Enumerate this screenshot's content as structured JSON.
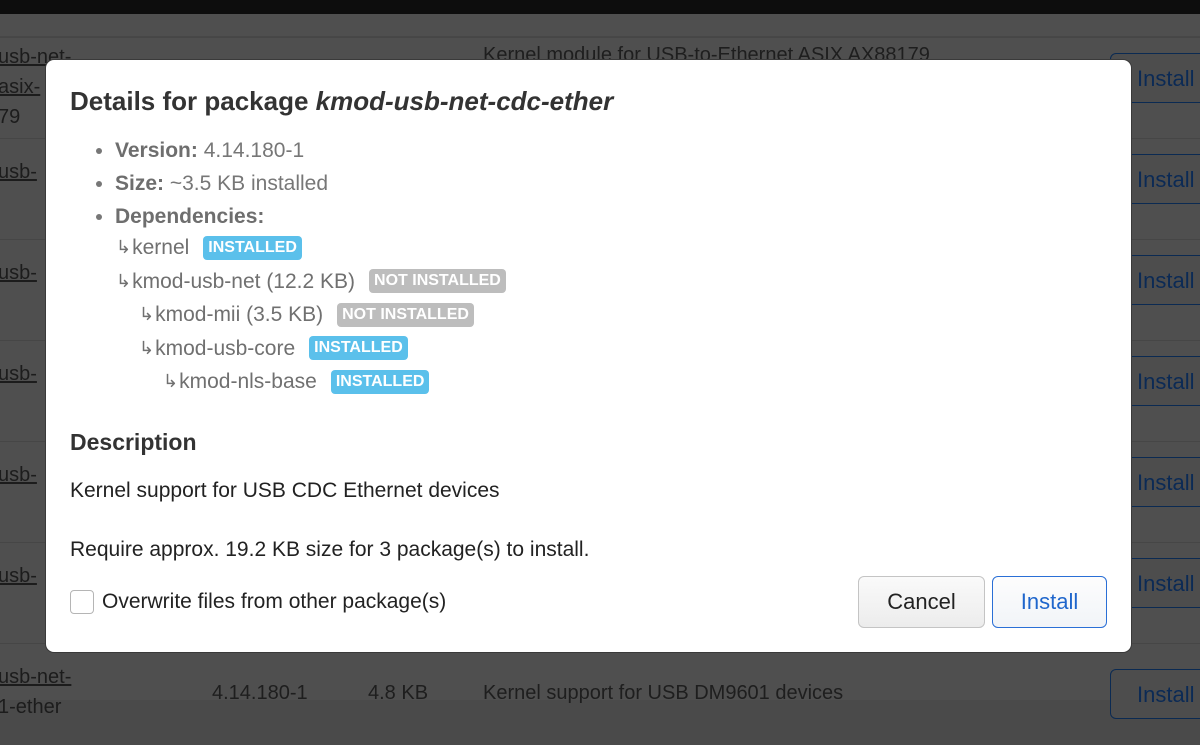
{
  "background": {
    "rows": [
      {
        "pkg_line1": "usb-net-asix-",
        "pkg_line2": "79",
        "version": "",
        "size": "",
        "desc": "Kernel module for USB-to-Ethernet ASIX AX88179",
        "install_label": "Install"
      },
      {
        "pkg_line1": "usb-",
        "pkg_line2": "",
        "version": "",
        "size": "",
        "desc": "",
        "install_label": "Install"
      },
      {
        "pkg_line1": "usb-",
        "pkg_line2": "",
        "version": "",
        "size": "",
        "desc": "",
        "install_label": "Install"
      },
      {
        "pkg_line1": "usb-",
        "pkg_line2": "",
        "version": "",
        "size": "",
        "desc": "",
        "install_label": "Install"
      },
      {
        "pkg_line1": "usb-",
        "pkg_line2": "",
        "version": "",
        "size": "",
        "desc": "",
        "install_label": "Install"
      },
      {
        "pkg_line1": "usb-",
        "pkg_line2": "",
        "version": "",
        "size": "",
        "desc": "",
        "install_label": "Install"
      },
      {
        "pkg_line1": "usb-net-",
        "pkg_line2": "1-ether",
        "version": "4.14.180-1",
        "size": "4.8 KB",
        "desc": "Kernel support for USB DM9601 devices",
        "install_label": "Install"
      }
    ]
  },
  "modal": {
    "title_prefix": "Details for package ",
    "package_name": "kmod-usb-net-cdc-ether",
    "info": {
      "version_label": "Version:",
      "version_value": " 4.14.180-1",
      "size_label": "Size:",
      "size_value": " ~3.5 KB installed",
      "deps_label": "Dependencies:"
    },
    "dependencies": [
      {
        "name": "kernel",
        "level": 0,
        "status": "INSTALLED",
        "installed": true
      },
      {
        "name": "kmod-usb-net (12.2 KB)",
        "level": 0,
        "status": "NOT INSTALLED",
        "installed": false
      },
      {
        "name": "kmod-mii (3.5 KB)",
        "level": 1,
        "status": "NOT INSTALLED",
        "installed": false
      },
      {
        "name": "kmod-usb-core",
        "level": 1,
        "status": "INSTALLED",
        "installed": true
      },
      {
        "name": "kmod-nls-base",
        "level": 2,
        "status": "INSTALLED",
        "installed": true
      }
    ],
    "arrow_glyph": "↳",
    "description_heading": "Description",
    "description_text": "Kernel support for USB CDC Ethernet devices",
    "require_text": "Require approx. 19.2 KB size for 3 package(s) to install.",
    "overwrite_label": "Overwrite files from other package(s)",
    "overwrite_checked": false,
    "cancel_label": "Cancel",
    "install_label": "Install"
  },
  "colors": {
    "installed_badge": "#5bc0eb",
    "not_installed_badge": "#bdbdbd",
    "primary_button": "#1f66cc"
  }
}
